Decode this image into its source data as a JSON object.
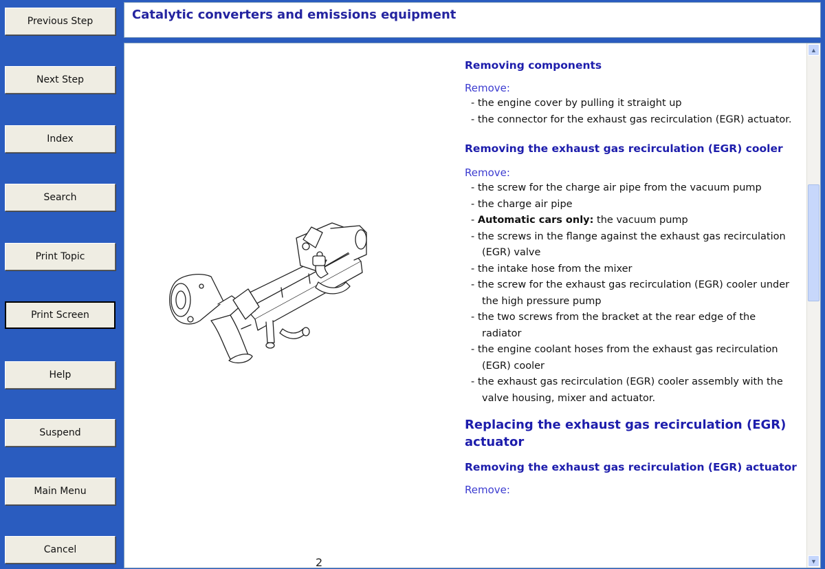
{
  "nav": {
    "buttons": [
      {
        "label": "Previous Step"
      },
      {
        "label": "Next Step"
      },
      {
        "label": "Index"
      },
      {
        "label": "Search"
      },
      {
        "label": "Print Topic"
      },
      {
        "label": "Print Screen"
      },
      {
        "label": "Help"
      },
      {
        "label": "Suspend"
      },
      {
        "label": "Main Menu"
      },
      {
        "label": "Cancel"
      }
    ]
  },
  "header": {
    "title": "Catalytic converters and emissions equipment"
  },
  "figure": {
    "number": "2",
    "icon": "egr-cooler-assembly-illustration"
  },
  "content": {
    "sec1": {
      "heading": "Removing components",
      "remove_label": "Remove:",
      "steps": [
        "the engine cover by pulling it straight up",
        "the connector for the exhaust gas recirculation (EGR) actuator."
      ]
    },
    "sec2": {
      "heading": "Removing the exhaust gas recirculation (EGR) cooler",
      "remove_label": "Remove:",
      "step1": "the screw for the charge air pipe from the vacuum pump",
      "step2": "the charge air pipe",
      "step3_bold": "Automatic cars only:",
      "step3_rest": " the vacuum pump",
      "step4": "the screws in the flange against the exhaust gas recirculation (EGR) valve",
      "step5": "the intake hose from the mixer",
      "step6": "the screw for the exhaust gas recirculation (EGR) cooler under the high pressure pump",
      "step7": "the two screws from the bracket at the rear edge of the radiator",
      "step8": "the engine coolant hoses from the exhaust gas recirculation (EGR) cooler",
      "step9": "the exhaust gas recirculation (EGR) cooler assembly with the valve housing, mixer and actuator."
    },
    "sec3": {
      "heading": "Replacing the exhaust gas recirculation (EGR) actuator"
    },
    "sec4": {
      "heading": "Removing the exhaust gas recirculation (EGR) actuator",
      "remove_label": "Remove:"
    }
  },
  "scrollbar": {
    "up_icon": "scroll-up-arrow-icon",
    "down_icon": "scroll-down-arrow-icon"
  }
}
